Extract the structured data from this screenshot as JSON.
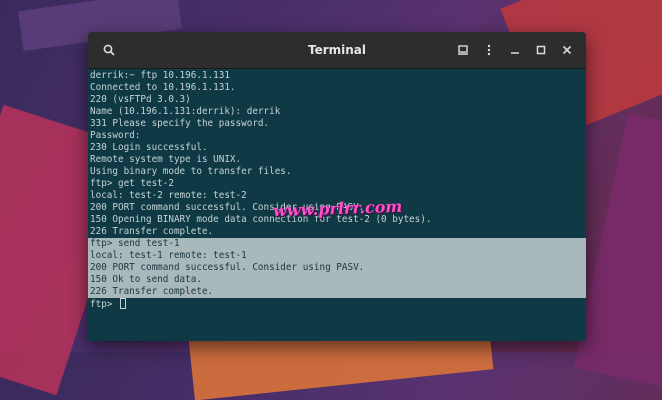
{
  "window": {
    "title": "Terminal"
  },
  "icons": {
    "search": "search-icon",
    "new_tab": "new-tab-icon",
    "menu": "menu-icon",
    "minimize": "minimize-icon",
    "maximize": "maximize-icon",
    "close": "close-icon"
  },
  "terminal": {
    "lines": [
      "derrik:~ ftp 10.196.1.131",
      "Connected to 10.196.1.131.",
      "220 (vsFTPd 3.0.3)",
      "Name (10.196.1.131:derrik): derrik",
      "331 Please specify the password.",
      "Password:",
      "230 Login successful.",
      "Remote system type is UNIX.",
      "Using binary mode to transfer files.",
      "ftp> get test-2",
      "local: test-2 remote: test-2",
      "200 PORT command successful. Consider using PASV.",
      "150 Opening BINARY mode data connection for test-2 (0 bytes).",
      "226 Transfer complete.",
      "ftp> send test-1",
      "local: test-1 remote: test-1",
      "200 PORT command successful. Consider using PASV.",
      "150 Ok to send data.",
      "226 Transfer complete."
    ],
    "prompt": "ftp>"
  },
  "watermark": "www.prlrr.com",
  "colors": {
    "terminal_bg": "#0f3a45",
    "selection_bg": "#a9b8bb",
    "titlebar_bg": "#2d2d2d"
  }
}
